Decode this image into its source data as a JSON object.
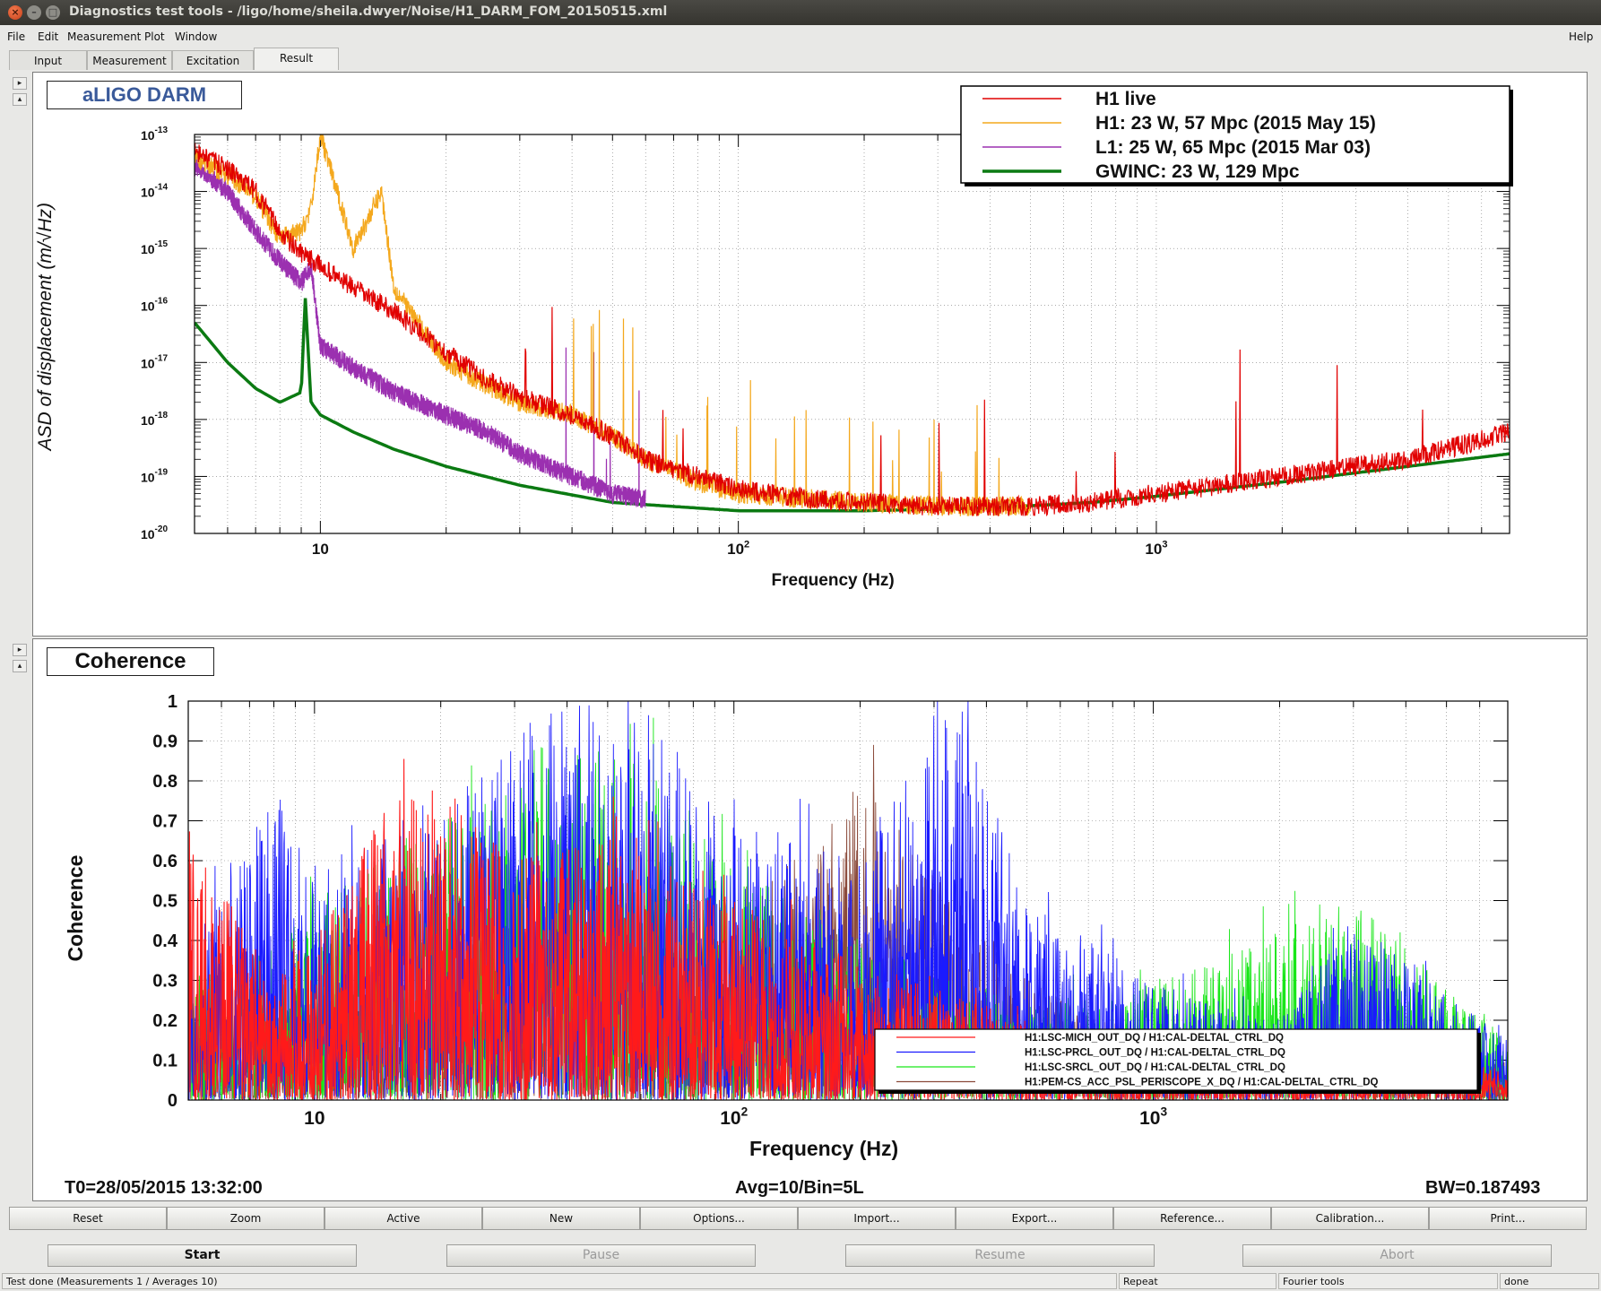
{
  "window": {
    "title": "Diagnostics test tools - /ligo/home/sheila.dwyer/Noise/H1_DARM_FOM_20150515.xml",
    "close_glyph": "×",
    "min_glyph": "–",
    "max_glyph": "□"
  },
  "menu": {
    "file": "File",
    "edit": "Edit",
    "measurement": "Measurement",
    "plot": "Plot",
    "window": "Window",
    "help": "Help"
  },
  "tabs": [
    {
      "label": "Input"
    },
    {
      "label": "Measurement"
    },
    {
      "label": "Excitation"
    },
    {
      "label": "Result"
    }
  ],
  "top_plot": {
    "name_label": "aLIGO DARM",
    "ylabel": "ASD of displacement (m/√Hz)",
    "xlabel": "Frequency (Hz)",
    "x_ticks": [
      "10",
      "10",
      "10"
    ],
    "x_tick_exp": [
      "",
      "2",
      "3"
    ],
    "y_ticks_exp": [
      "-13",
      "-14",
      "-15",
      "-16",
      "-17",
      "-18",
      "-19",
      "-20"
    ],
    "legend": [
      {
        "label": "H1 live",
        "color": "#e10000"
      },
      {
        "label": "H1: 23 W, 57 Mpc (2015 May 15)",
        "color": "#f4a81d"
      },
      {
        "label": "L1: 25 W, 65 Mpc (2015 Mar 03)",
        "color": "#9b30b0"
      },
      {
        "label": "GWINC: 23 W, 129 Mpc",
        "color": "#0b7a12"
      }
    ]
  },
  "bottom_plot": {
    "name_label": "Coherence",
    "ylabel": "Coherence",
    "xlabel": "Frequency (Hz)",
    "y_ticks": [
      "0",
      "0.1",
      "0.2",
      "0.3",
      "0.4",
      "0.5",
      "0.6",
      "0.7",
      "0.8",
      "0.9",
      "1"
    ],
    "legend": [
      {
        "label": "H1:LSC-MICH_OUT_DQ / H1:CAL-DELTAL_CTRL_DQ",
        "color": "#ff1a1a"
      },
      {
        "label": "H1:LSC-PRCL_OUT_DQ / H1:CAL-DELTAL_CTRL_DQ",
        "color": "#1a1aff"
      },
      {
        "label": "H1:LSC-SRCL_OUT_DQ / H1:CAL-DELTAL_CTRL_DQ",
        "color": "#19e619"
      },
      {
        "label": "H1:PEM-CS_ACC_PSL_PERISCOPE_X_DQ / H1:CAL-DELTAL_CTRL_DQ",
        "color": "#8b4a3a"
      }
    ]
  },
  "info": {
    "t0": "T0=28/05/2015 13:32:00",
    "avg": "Avg=10/Bin=5L",
    "bw": "BW=0.187493"
  },
  "buttons": [
    "Reset",
    "Zoom",
    "Active",
    "New",
    "Options...",
    "Import...",
    "Export...",
    "Reference...",
    "Calibration...",
    "Print..."
  ],
  "controls": {
    "start": "Start",
    "pause": "Pause",
    "resume": "Resume",
    "abort": "Abort"
  },
  "status": {
    "message": "Test done (Measurements 1 / Averages 10)",
    "repeat": "Repeat",
    "fourier": "Fourier tools",
    "state": "done"
  },
  "chart_data": [
    {
      "type": "line",
      "title": "aLIGO DARM",
      "xlabel": "Frequency (Hz)",
      "ylabel": "ASD of displacement (m/√Hz)",
      "x_scale": "log",
      "y_scale": "log",
      "xlim": [
        5,
        7000
      ],
      "ylim": [
        1e-20,
        1e-13
      ],
      "grid": true,
      "legend_position": "top-right",
      "series": [
        {
          "name": "H1 live",
          "color": "#e10000",
          "x": [
            5,
            6,
            7,
            8,
            9,
            10,
            12,
            15,
            20,
            25,
            30,
            40,
            50,
            60,
            80,
            100,
            150,
            200,
            300,
            500,
            700,
            1000,
            2000,
            4000,
            7000
          ],
          "y": [
            5e-14,
            2.5e-14,
            1e-14,
            2e-15,
            8e-16,
            5e-16,
            2e-16,
            8e-17,
            1.5e-17,
            5e-18,
            2.5e-18,
            1.2e-18,
            5e-19,
            2e-19,
            1e-19,
            6e-20,
            4e-20,
            3.5e-20,
            3e-20,
            3e-20,
            3.5e-20,
            5e-20,
            1e-19,
            2e-19,
            6e-19
          ]
        },
        {
          "name": "H1: 23 W, 57 Mpc (2015 May 15)",
          "color": "#f4a81d",
          "x": [
            5,
            6,
            7,
            8,
            9,
            9.5,
            10,
            12,
            14,
            15,
            20,
            25,
            30,
            40,
            50,
            60,
            80,
            100,
            150,
            200,
            300,
            500
          ],
          "y": [
            4e-14,
            2e-14,
            8e-15,
            1.5e-15,
            2e-15,
            5e-15,
            1e-13,
            1e-15,
            1e-14,
            2e-16,
            1e-17,
            4e-18,
            2e-18,
            1.2e-18,
            5e-19,
            2e-19,
            8e-20,
            5e-20,
            4e-20,
            3.5e-20,
            3e-20,
            3e-20
          ]
        },
        {
          "name": "L1: 25 W, 65 Mpc (2015 Mar 03)",
          "color": "#9b30b0",
          "x": [
            5,
            6,
            7,
            8,
            9,
            9.5,
            10,
            12,
            15,
            20,
            25,
            30,
            40,
            50,
            60
          ],
          "y": [
            3e-14,
            1e-14,
            2e-15,
            6e-16,
            2.5e-16,
            5e-16,
            2e-17,
            8e-18,
            3e-18,
            1.2e-18,
            6e-19,
            2.5e-19,
            1e-19,
            5e-20,
            4e-20
          ]
        },
        {
          "name": "GWINC: 23 W, 129 Mpc",
          "color": "#0b7a12",
          "x": [
            5,
            6,
            7,
            8,
            9,
            9.2,
            9.5,
            10,
            12,
            15,
            20,
            30,
            50,
            100,
            200,
            400,
            700,
            1000,
            2000,
            4000,
            7000
          ],
          "y": [
            5e-17,
            1e-17,
            3.5e-18,
            2e-18,
            3e-18,
            1.5e-16,
            2e-18,
            1.2e-18,
            6e-19,
            3e-19,
            1.5e-19,
            7e-20,
            3.5e-20,
            2.5e-20,
            2.5e-20,
            2.8e-20,
            3.5e-20,
            4.5e-20,
            8e-20,
            1.5e-19,
            2.5e-19
          ]
        }
      ]
    },
    {
      "type": "line",
      "title": "Coherence",
      "xlabel": "Frequency (Hz)",
      "ylabel": "Coherence",
      "x_scale": "log",
      "xlim": [
        5,
        7000
      ],
      "ylim": [
        0,
        1
      ],
      "grid": true,
      "legend_position": "bottom-right",
      "series": [
        {
          "name": "H1:LSC-MICH_OUT_DQ / H1:CAL-DELTAL_CTRL_DQ",
          "color": "#ff1a1a",
          "x": [
            5,
            6,
            8,
            10,
            15,
            20,
            30,
            50,
            100,
            200,
            500,
            1000,
            3000,
            7000
          ],
          "y": [
            0.7,
            0.55,
            0.3,
            0.4,
            0.75,
            0.8,
            0.6,
            0.65,
            0.5,
            0.35,
            0.2,
            0.1,
            0.1,
            0.08
          ]
        },
        {
          "name": "H1:LSC-PRCL_OUT_DQ / H1:CAL-DELTAL_CTRL_DQ",
          "color": "#1a1aff",
          "x": [
            5,
            8,
            10,
            20,
            30,
            40,
            60,
            100,
            200,
            300,
            350,
            500,
            1000,
            2000,
            3000,
            7000
          ],
          "y": [
            0.4,
            0.8,
            0.6,
            0.7,
            0.97,
            1.0,
            1.0,
            0.7,
            0.6,
            0.97,
            0.98,
            0.5,
            0.3,
            0.2,
            0.45,
            0.15
          ]
        },
        {
          "name": "H1:LSC-SRCL_OUT_DQ / H1:CAL-DELTAL_CTRL_DQ",
          "color": "#19e619",
          "x": [
            5,
            8,
            10,
            20,
            40,
            60,
            100,
            200,
            500,
            1000,
            3000,
            7000
          ],
          "y": [
            0.3,
            0.4,
            0.5,
            0.7,
            0.9,
            0.85,
            0.6,
            0.4,
            0.25,
            0.3,
            0.5,
            0.15
          ]
        },
        {
          "name": "H1:PEM-CS_ACC_PSL_PERISCOPE_X_DQ / H1:CAL-DELTAL_CTRL_DQ",
          "color": "#8b4a3a",
          "x": [
            5,
            10,
            20,
            50,
            100,
            200,
            500,
            1000,
            7000
          ],
          "y": [
            0.2,
            0.3,
            0.4,
            0.5,
            0.45,
            0.8,
            0.3,
            0.15,
            0.1
          ]
        }
      ]
    }
  ]
}
